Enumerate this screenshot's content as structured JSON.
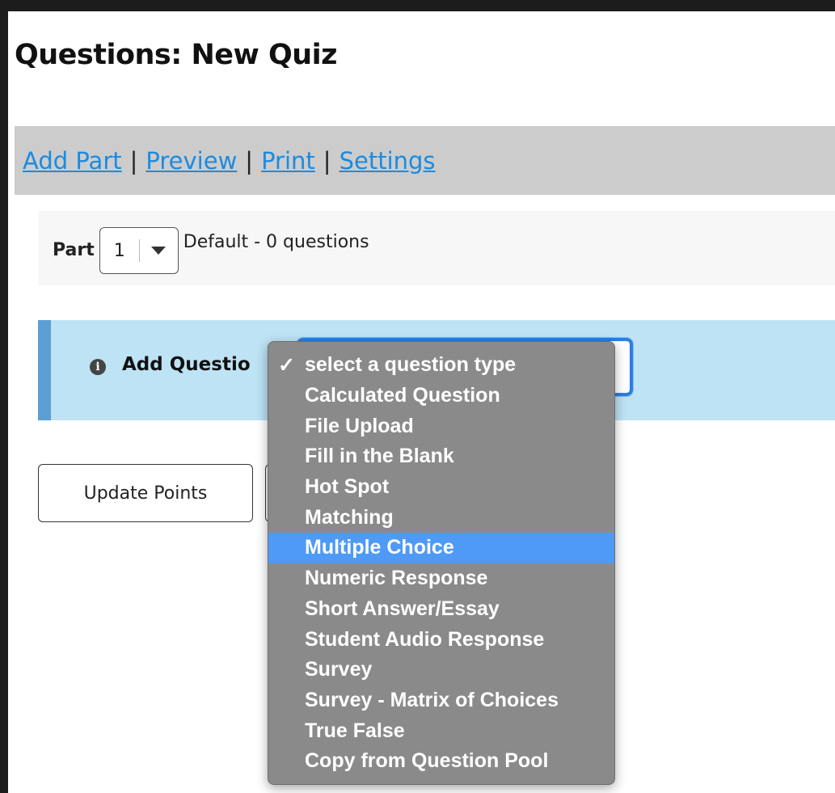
{
  "page": {
    "title": "Questions: New Quiz"
  },
  "toolbar": {
    "links": [
      "Add Part",
      "Preview",
      "Print",
      "Settings"
    ],
    "separator": "|"
  },
  "part": {
    "label": "Part",
    "selected_value": "1",
    "description": "Default - 0 questions"
  },
  "add_question": {
    "label": "Add Questio",
    "dropdown": {
      "selected_index": 0,
      "highlighted_index": 6,
      "check_glyph": "✓",
      "options": [
        "select a question type",
        "Calculated Question",
        "File Upload",
        "Fill in the Blank",
        "Hot Spot",
        "Matching",
        "Multiple Choice",
        "Numeric Response",
        "Short Answer/Essay",
        "Student Audio Response",
        "Survey",
        "Survey - Matrix of Choices",
        "True False",
        "Copy from Question Pool"
      ]
    }
  },
  "buttons": {
    "update_points": "Update Points"
  },
  "colors": {
    "link": "#1a8be0",
    "toolbar_bg": "#cccccc",
    "add_row_bg": "#bde3f4",
    "add_row_accent": "#5b9fd4",
    "dropdown_bg": "#8a8a8a",
    "dropdown_highlight": "#4e9af6",
    "focus_ring": "#2b7fe0"
  }
}
